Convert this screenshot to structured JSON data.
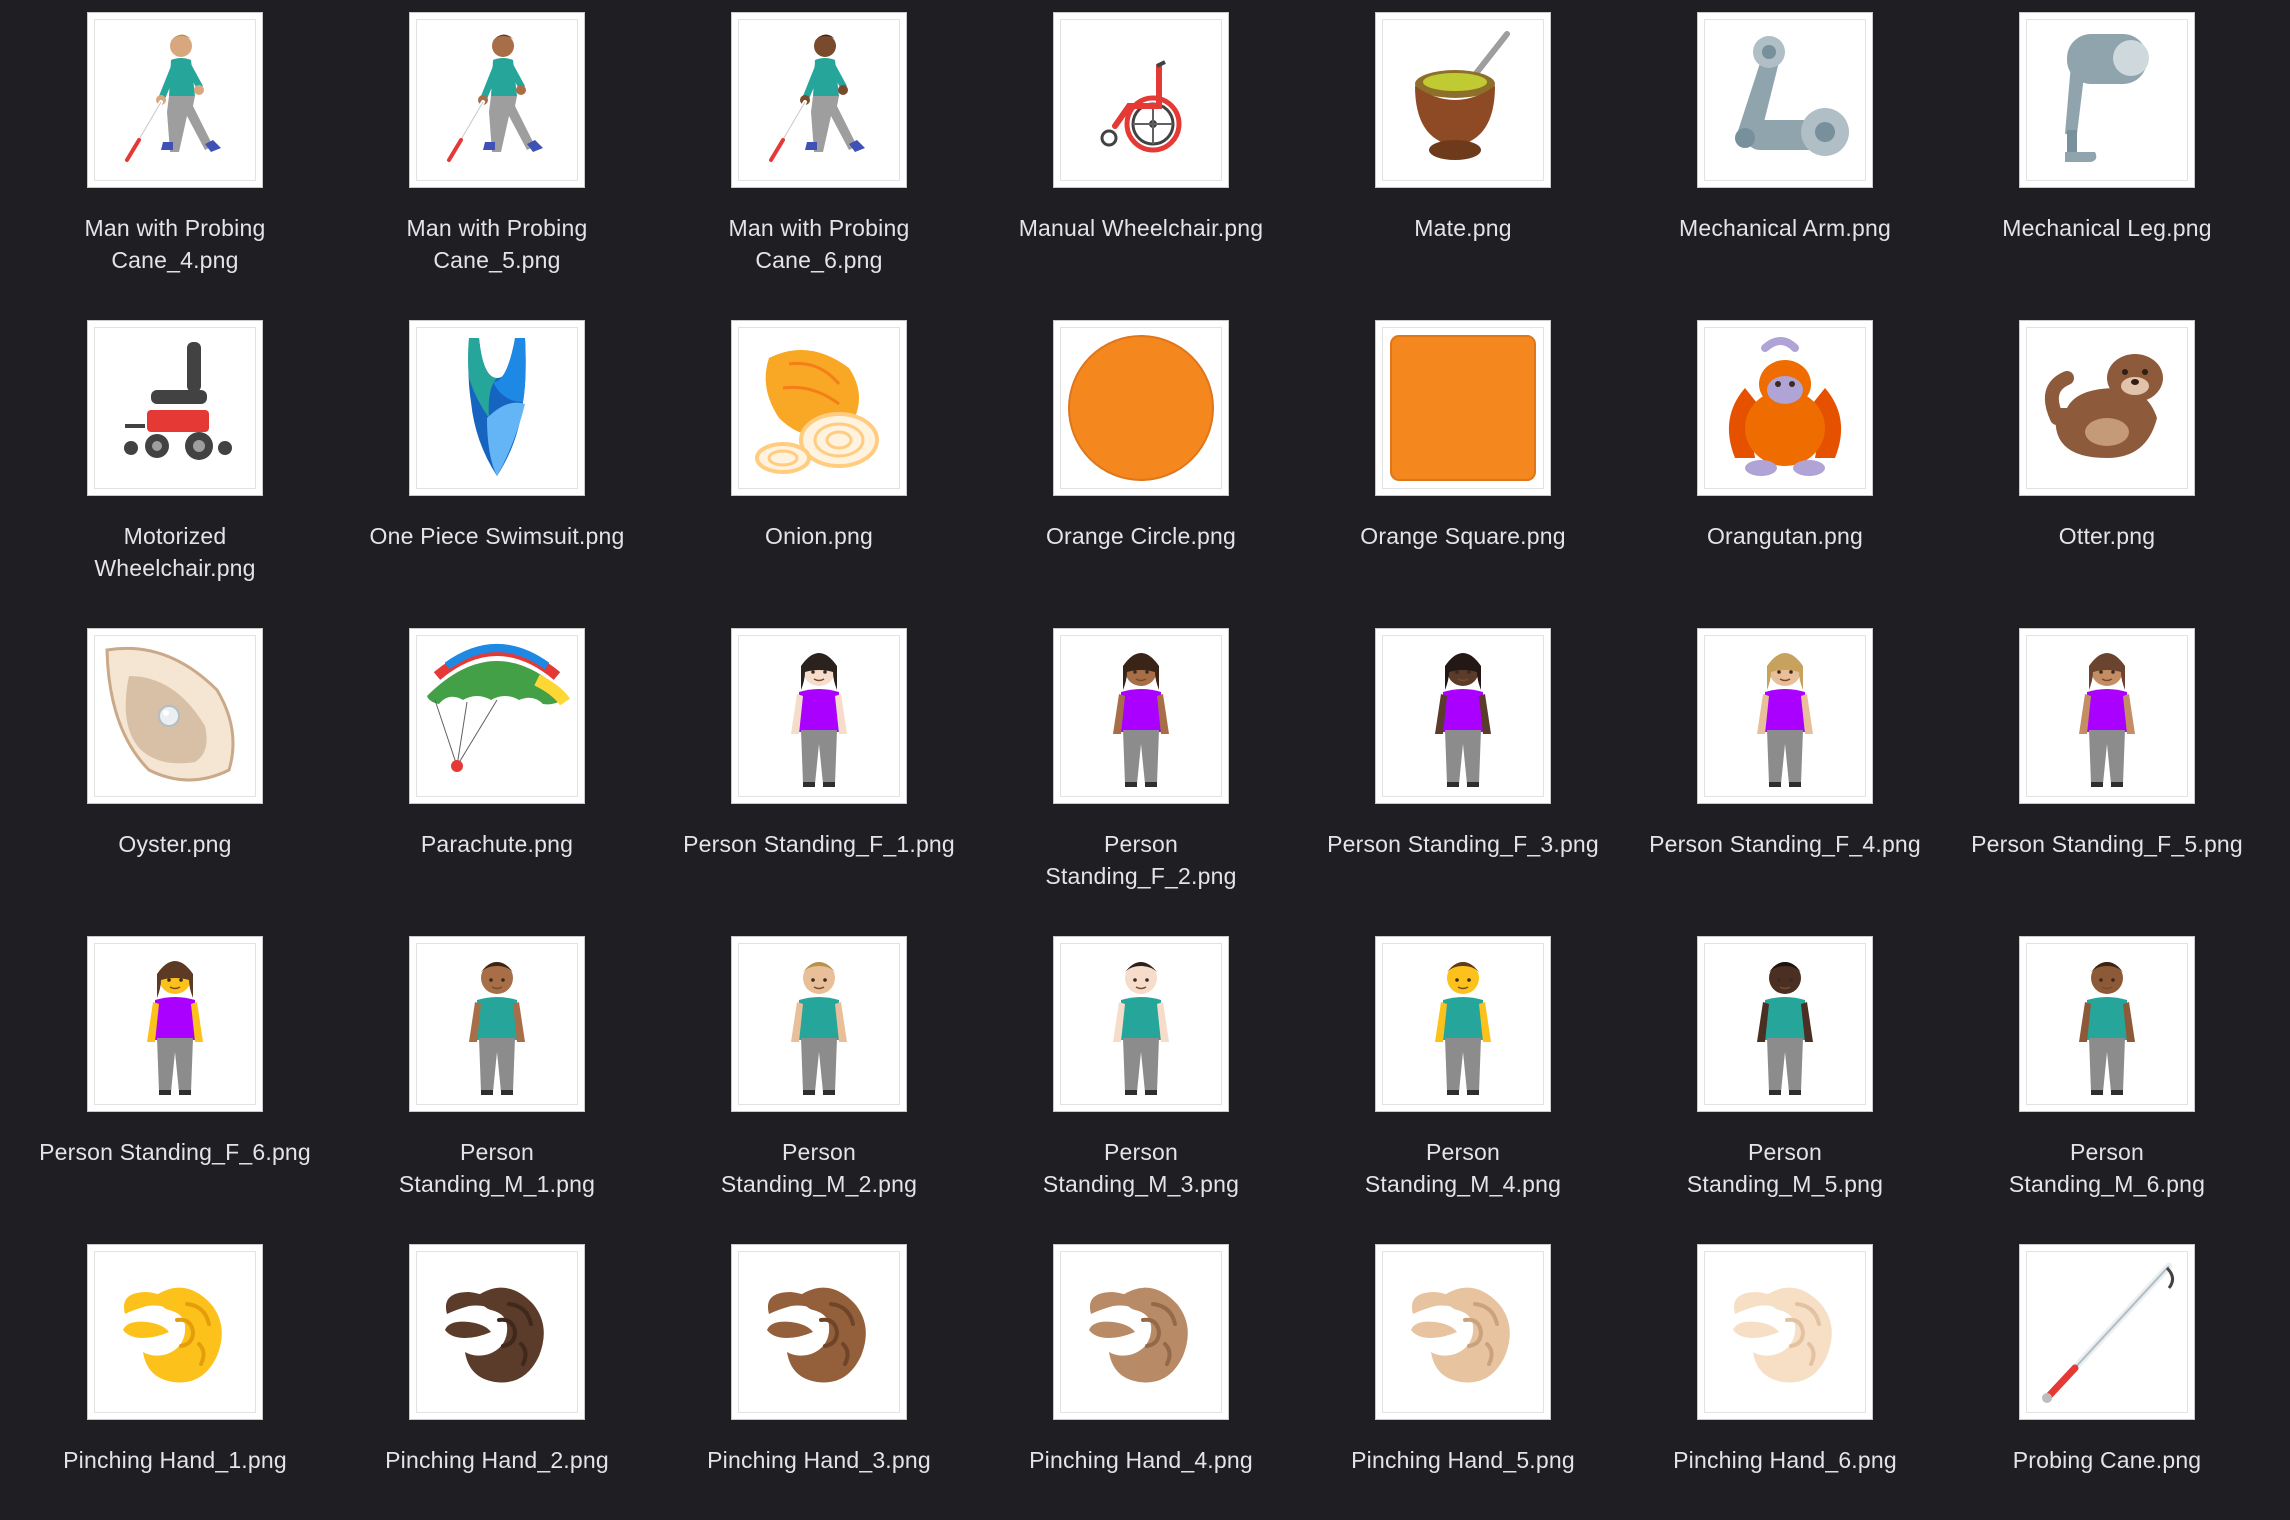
{
  "window": {
    "background": "#1f1f23"
  },
  "files": [
    {
      "name": "Man with Probing Cane_4.png",
      "label_lines": [
        "Man with Probing",
        "Cane_4.png"
      ],
      "icon": "man-probing-cane-icon",
      "skin": "#d8a77e",
      "hair": "#b5934f"
    },
    {
      "name": "Man with Probing Cane_5.png",
      "label_lines": [
        "Man with Probing",
        "Cane_5.png"
      ],
      "icon": "man-probing-cane-icon",
      "skin": "#a86e48",
      "hair": "#5b3b26"
    },
    {
      "name": "Man with Probing Cane_6.png",
      "label_lines": [
        "Man with Probing",
        "Cane_6.png"
      ],
      "icon": "man-probing-cane-icon",
      "skin": "#7a4a2d",
      "hair": "#3a2418"
    },
    {
      "name": "Manual Wheelchair.png",
      "label_lines": [
        "Manual Wheelchair.png"
      ],
      "icon": "manual-wheelchair-icon"
    },
    {
      "name": "Mate.png",
      "label_lines": [
        "Mate.png"
      ],
      "icon": "mate-icon"
    },
    {
      "name": "Mechanical Arm.png",
      "label_lines": [
        "Mechanical Arm.png"
      ],
      "icon": "mechanical-arm-icon"
    },
    {
      "name": "Mechanical Leg.png",
      "label_lines": [
        "Mechanical Leg.png"
      ],
      "icon": "mechanical-leg-icon"
    },
    {
      "name": "Motorized Wheelchair.png",
      "label_lines": [
        "Motorized",
        "Wheelchair.png"
      ],
      "icon": "motorized-wheelchair-icon"
    },
    {
      "name": "One Piece Swimsuit.png",
      "label_lines": [
        "One Piece Swimsuit.png"
      ],
      "icon": "one-piece-swimsuit-icon"
    },
    {
      "name": "Onion.png",
      "label_lines": [
        "Onion.png"
      ],
      "icon": "onion-icon"
    },
    {
      "name": "Orange Circle.png",
      "label_lines": [
        "Orange Circle.png"
      ],
      "icon": "orange-circle-icon"
    },
    {
      "name": "Orange Square.png",
      "label_lines": [
        "Orange Square.png"
      ],
      "icon": "orange-square-icon"
    },
    {
      "name": "Orangutan.png",
      "label_lines": [
        "Orangutan.png"
      ],
      "icon": "orangutan-icon"
    },
    {
      "name": "Otter.png",
      "label_lines": [
        "Otter.png"
      ],
      "icon": "otter-icon"
    },
    {
      "name": "Oyster.png",
      "label_lines": [
        "Oyster.png"
      ],
      "icon": "oyster-icon"
    },
    {
      "name": "Parachute.png",
      "label_lines": [
        "Parachute.png"
      ],
      "icon": "parachute-icon"
    },
    {
      "name": "Person Standing_F_1.png",
      "label_lines": [
        "Person Standing_F_1.png"
      ],
      "icon": "woman-standing-icon",
      "skin": "#f6dccb",
      "hair": "#2b211d"
    },
    {
      "name": "Person Standing_F_2.png",
      "label_lines": [
        "Person",
        "Standing_F_2.png"
      ],
      "icon": "woman-standing-icon",
      "skin": "#a86e48",
      "hair": "#3a2418"
    },
    {
      "name": "Person Standing_F_3.png",
      "label_lines": [
        "Person Standing_F_3.png"
      ],
      "icon": "woman-standing-icon",
      "skin": "#5b3b2a",
      "hair": "#231815"
    },
    {
      "name": "Person Standing_F_4.png",
      "label_lines": [
        "Person Standing_F_4.png"
      ],
      "icon": "woman-standing-icon",
      "skin": "#e8bf98",
      "hair": "#c6a25e"
    },
    {
      "name": "Person Standing_F_5.png",
      "label_lines": [
        "Person Standing_F_5.png"
      ],
      "icon": "woman-standing-icon",
      "skin": "#c58d63",
      "hair": "#6b4430"
    },
    {
      "name": "Person Standing_F_6.png",
      "label_lines": [
        "Person Standing_F_6.png"
      ],
      "icon": "woman-standing-icon",
      "skin": "#fcc21b",
      "hair": "#5d3a23"
    },
    {
      "name": "Person Standing_M_1.png",
      "label_lines": [
        "Person",
        "Standing_M_1.png"
      ],
      "icon": "man-standing-icon",
      "skin": "#a86e48",
      "hair": "#3a2418"
    },
    {
      "name": "Person Standing_M_2.png",
      "label_lines": [
        "Person",
        "Standing_M_2.png"
      ],
      "icon": "man-standing-icon",
      "skin": "#e8bf98",
      "hair": "#b5934f"
    },
    {
      "name": "Person Standing_M_3.png",
      "label_lines": [
        "Person",
        "Standing_M_3.png"
      ],
      "icon": "man-standing-icon",
      "skin": "#f6dccb",
      "hair": "#2b211d"
    },
    {
      "name": "Person Standing_M_4.png",
      "label_lines": [
        "Person",
        "Standing_M_4.png"
      ],
      "icon": "man-standing-icon",
      "skin": "#fcc21b",
      "hair": "#5d3a23"
    },
    {
      "name": "Person Standing_M_5.png",
      "label_lines": [
        "Person",
        "Standing_M_5.png"
      ],
      "icon": "man-standing-icon",
      "skin": "#4a2f22",
      "hair": "#1d1411"
    },
    {
      "name": "Person Standing_M_6.png",
      "label_lines": [
        "Person",
        "Standing_M_6.png"
      ],
      "icon": "man-standing-icon",
      "skin": "#8d5a38",
      "hair": "#3a2418"
    },
    {
      "name": "Pinching Hand_1.png",
      "label_lines": [
        "Pinching Hand_1.png"
      ],
      "icon": "pinching-hand-icon",
      "skin": "#fcc21b",
      "shade": "#e49e0a"
    },
    {
      "name": "Pinching Hand_2.png",
      "label_lines": [
        "Pinching Hand_2.png"
      ],
      "icon": "pinching-hand-icon",
      "skin": "#5b3b2a",
      "shade": "#3f281c"
    },
    {
      "name": "Pinching Hand_3.png",
      "label_lines": [
        "Pinching Hand_3.png"
      ],
      "icon": "pinching-hand-icon",
      "skin": "#94603c",
      "shade": "#6f4428"
    },
    {
      "name": "Pinching Hand_4.png",
      "label_lines": [
        "Pinching Hand_4.png"
      ],
      "icon": "pinching-hand-icon",
      "skin": "#b98a66",
      "shade": "#94694a"
    },
    {
      "name": "Pinching Hand_5.png",
      "label_lines": [
        "Pinching Hand_5.png"
      ],
      "icon": "pinching-hand-icon",
      "skin": "#e7c3a0",
      "shade": "#caa27d"
    },
    {
      "name": "Pinching Hand_6.png",
      "label_lines": [
        "Pinching Hand_6.png"
      ],
      "icon": "pinching-hand-icon",
      "skin": "#f7dfc6",
      "shade": "#e3c2a2"
    },
    {
      "name": "Probing Cane.png",
      "label_lines": [
        "Probing Cane.png"
      ],
      "icon": "probing-cane-icon"
    }
  ]
}
